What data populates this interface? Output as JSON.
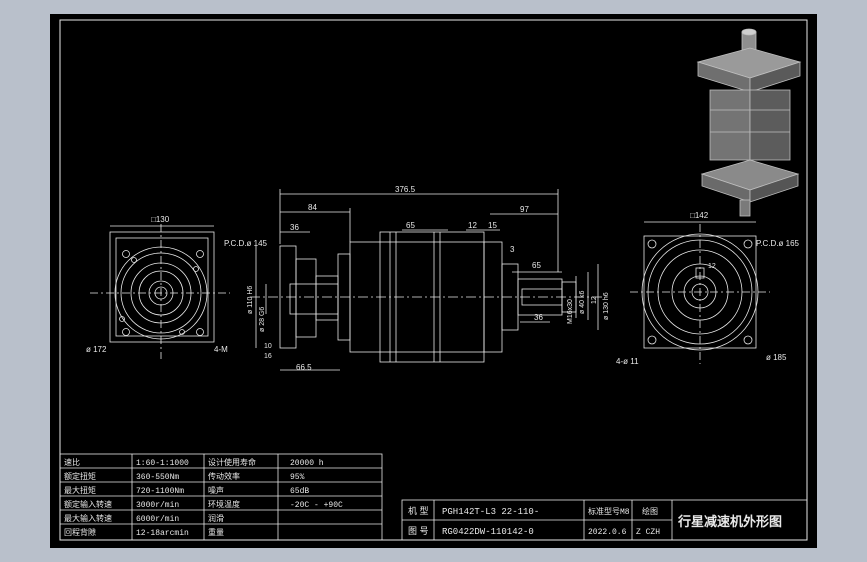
{
  "dimensions": {
    "left_square": "□130",
    "left_pcd": "P.C.D.ø 145",
    "left_dia": "ø 172",
    "left_holes": "4-M",
    "overall_length": "376.5",
    "flange_len": "84",
    "flange_thk": "36",
    "body_len": "65",
    "shaft_key_len": "97",
    "dim_12": "12",
    "dim_15": "15",
    "dim_3": "3",
    "dim_key_65": "65",
    "dim_36": "36",
    "dim_66_5": "66.5",
    "dim_10": "10",
    "dim_16": "16",
    "input_bore": "ø 110 H6",
    "input_bore2": "ø 28 G6",
    "output_dia": "ø 40 k6",
    "output_pilot": "ø 130 h6",
    "output_thread": "M16x30",
    "output_key": "12",
    "right_square": "□142",
    "right_pcd": "P.C.D.ø 165",
    "right_dia": "ø 185",
    "right_holes": "4-ø 11",
    "right_key": "12"
  },
  "spec_table": {
    "rows": [
      {
        "k1": "速比",
        "v1": "1:60-1:1000",
        "k2": "设计使用寿命",
        "v2": "20000 h"
      },
      {
        "k1": "额定扭矩",
        "v1": "360-550Nm",
        "k2": "传动效率",
        "v2": "95%"
      },
      {
        "k1": "最大扭矩",
        "v1": "720-1100Nm",
        "k2": "噪声",
        "v2": "65dB"
      },
      {
        "k1": "额定输入转速",
        "v1": "3000r/min",
        "k2": "环境温度",
        "v2": "-20C - +90C"
      },
      {
        "k1": "最大输入转速",
        "v1": "6000r/min",
        "k2": "润滑",
        "v2": ""
      },
      {
        "k1": "回程背隙",
        "v1": "12-18arcmin",
        "k2": "重量",
        "v2": ""
      }
    ]
  },
  "title_block": {
    "model_label": "机 型",
    "model_value": "PGH142T-L3   22-110-",
    "drawing_label": "图 号",
    "drawing_value": "RG0422DW-110142-0",
    "config_label": "标准型号",
    "config_value": "M8",
    "date_value": "2022.0.6",
    "drawn_label": "绘图",
    "drawn_value": "Z CZH",
    "title": "行星减速机外形图"
  }
}
